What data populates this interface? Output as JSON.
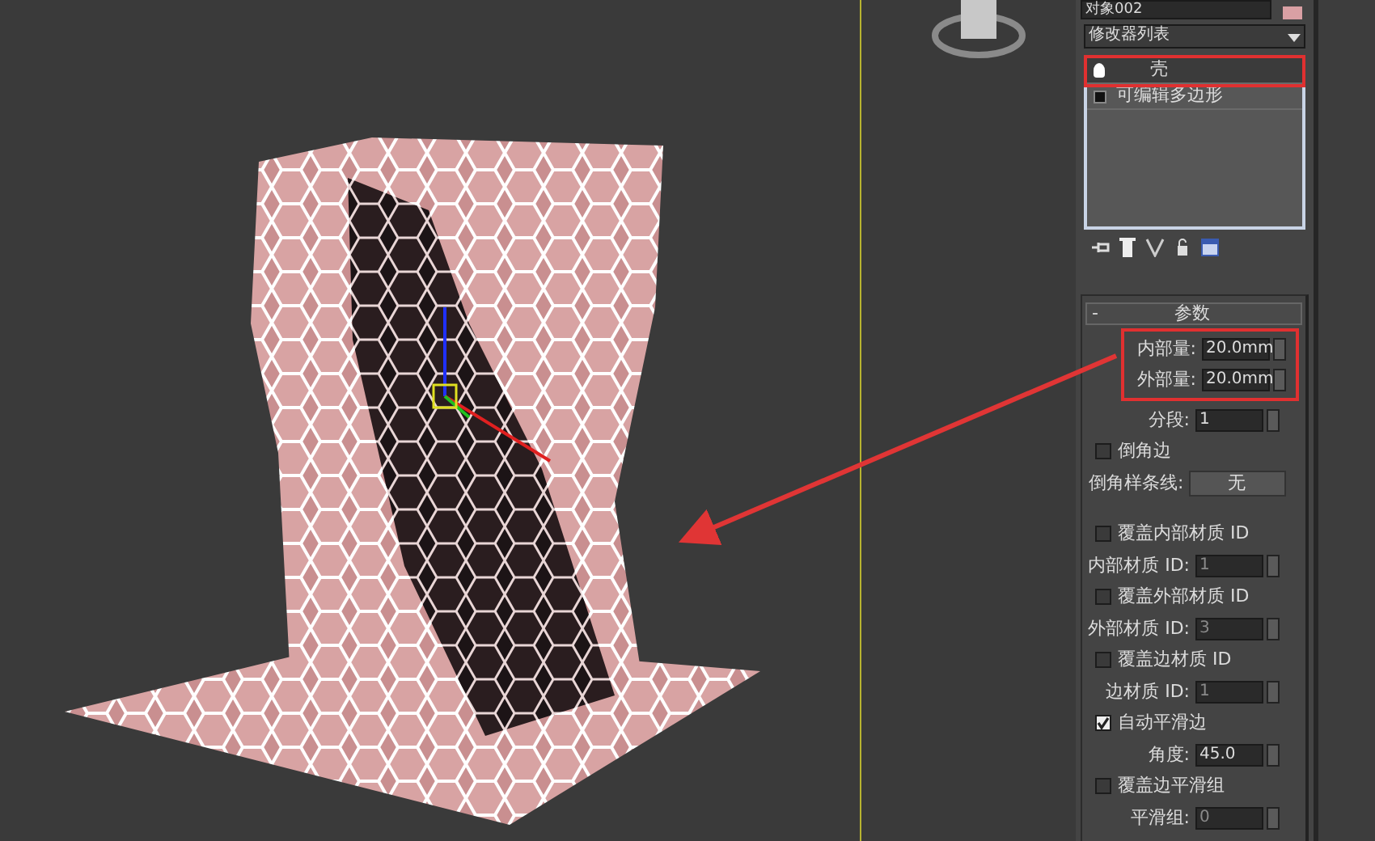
{
  "object_name": "对象002",
  "modifier_list": {
    "label": "修改器列表"
  },
  "modifier_stack": [
    {
      "label": "壳",
      "selected": true,
      "kind": "bulb"
    },
    {
      "label": "可编辑多边形",
      "selected": false,
      "kind": "square"
    }
  ],
  "rollout": {
    "toggle": "-",
    "title": "参数"
  },
  "params": [
    {
      "kind": "spinner",
      "label": "内部量:",
      "value": "20.0mm",
      "disabled": false,
      "highlighted": true
    },
    {
      "kind": "spinner",
      "label": "外部量:",
      "value": "20.0mm",
      "disabled": false,
      "highlighted": true
    },
    {
      "kind": "spinner",
      "label": "分段:",
      "value": "1",
      "disabled": false
    },
    {
      "kind": "checkbox",
      "label": "倒角边",
      "checked": false
    },
    {
      "kind": "button",
      "label": "倒角样条线:",
      "value": "无"
    },
    {
      "kind": "gap"
    },
    {
      "kind": "checkbox",
      "label": "覆盖内部材质 ID",
      "checked": false
    },
    {
      "kind": "spinner",
      "label": "内部材质 ID:",
      "value": "1",
      "disabled": true
    },
    {
      "kind": "checkbox",
      "label": "覆盖外部材质 ID",
      "checked": false
    },
    {
      "kind": "spinner",
      "label": "外部材质 ID:",
      "value": "3",
      "disabled": true
    },
    {
      "kind": "checkbox",
      "label": "覆盖边材质 ID",
      "checked": false
    },
    {
      "kind": "spinner",
      "label": "边材质 ID:",
      "value": "1",
      "disabled": true
    },
    {
      "kind": "checkbox",
      "label": "自动平滑边",
      "checked": true
    },
    {
      "kind": "spinner",
      "label": "角度:",
      "value": "45.0",
      "disabled": false
    },
    {
      "kind": "checkbox",
      "label": "覆盖边平滑组",
      "checked": false
    },
    {
      "kind": "spinner",
      "label": "平滑组:",
      "value": "0",
      "disabled": true
    }
  ]
}
